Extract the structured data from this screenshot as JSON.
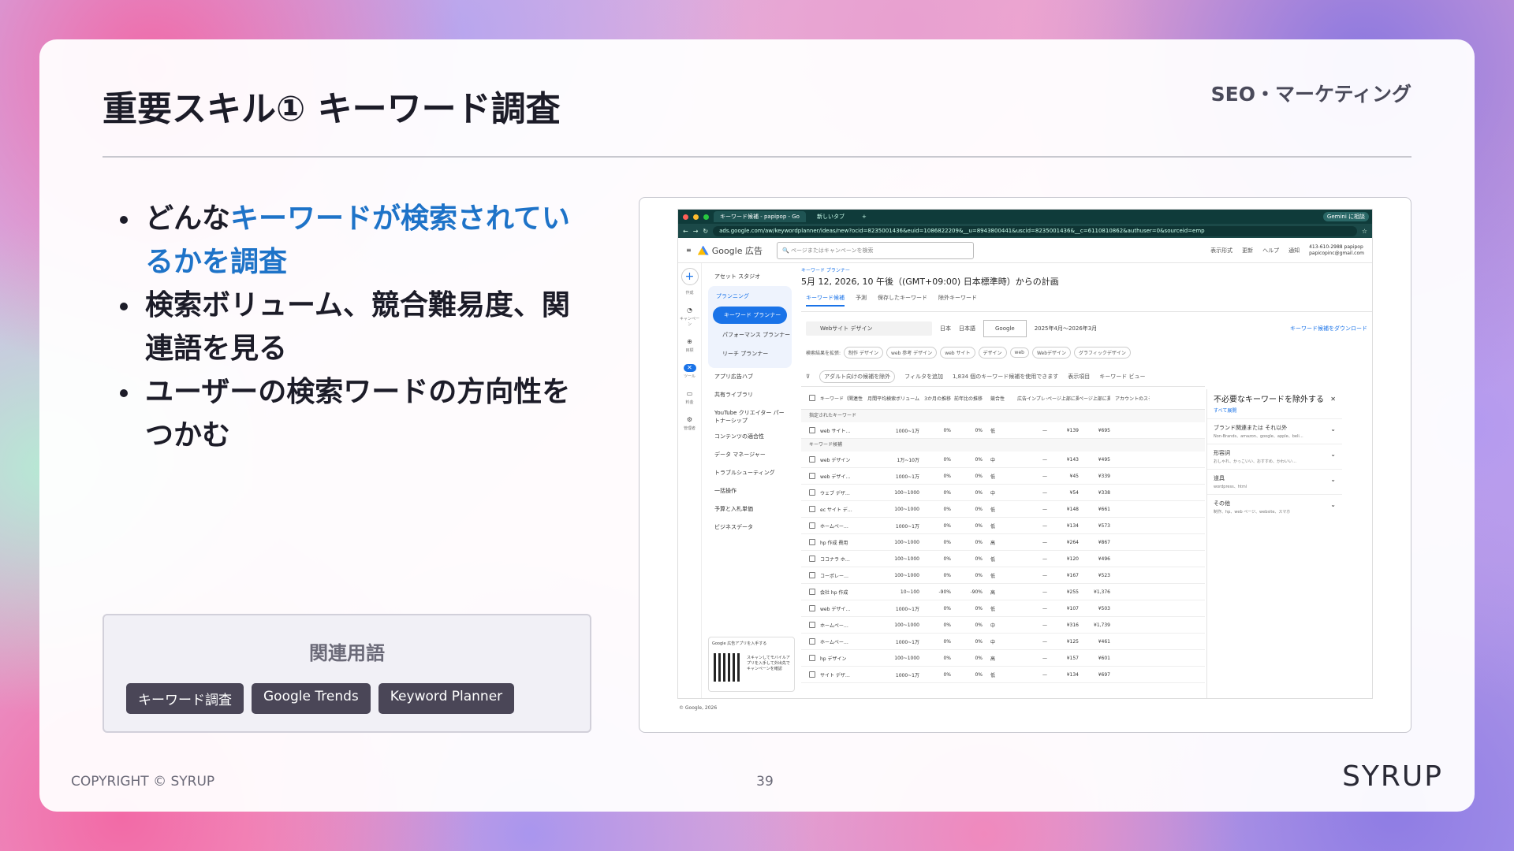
{
  "slide": {
    "title": "重要スキル① キーワード調査",
    "category": "SEO・マーケティング",
    "page": "39",
    "copyright": "COPYRIGHT © SYRUP",
    "logo": "SYRUP"
  },
  "bullets": [
    {
      "pre": "どんな",
      "hl": "キーワードが検索されているかを調査",
      "post": ""
    },
    {
      "pre": "検索ボリューム、競合難易度、関連語を見る",
      "hl": "",
      "post": ""
    },
    {
      "pre": "ユーザーの検索ワードの方向性をつかむ",
      "hl": "",
      "post": ""
    }
  ],
  "terms": {
    "heading": "関連用語",
    "tags": [
      "キーワード調査",
      "Google Trends",
      "Keyword Planner"
    ]
  },
  "browser": {
    "tab1": "キーワード候補 - papipop - Go",
    "tab2": "新しいタブ",
    "gemini": "Gemini に相談",
    "url": "ads.google.com/aw/keywordplanner/ideas/new?ocid=8235001436&euid=1086822209&__u=8943800441&uscid=8235001436&__c=6110810862&authuser=0&sourceid=emp",
    "brand": "Google 広告",
    "search_placeholder": "ページまたはキャンペーンを検索",
    "header_icons": [
      "表示形式",
      "更新",
      "ヘルプ",
      "通知"
    ],
    "account_line1": "413-610-2988 papipop",
    "account_line2": "papicopinc@gmail.com",
    "rail": [
      "作成",
      "キャンペーン",
      "目標",
      "ツール",
      "料金",
      "管理者"
    ],
    "nav": {
      "assets": "アセット スタジオ",
      "planning": "プランニング",
      "kp": "キーワード プランナー",
      "perf": "パフォーマンス プランナー",
      "reach": "リーチ プランナー",
      "others": [
        "アプリ広告ハブ",
        "共有ライブラリ",
        "YouTube クリエイター パートナーシップ",
        "コンテンツの適合性",
        "データ マネージャー",
        "トラブルシューティング",
        "一括操作",
        "予算と入札単価",
        "ビジネスデータ"
      ],
      "qr_title": "Google 広告アプリを入手する",
      "qr_text": "スキャンしてモバイルアプリを入手して外出先でキャンペーンを確認"
    },
    "breadcrumb": "キーワード プランナー",
    "plan_title": "5月 12, 2026, 10 午後（(GMT+09:00) 日本標準時）からの計画",
    "tabs": [
      "キーワード候補",
      "予測",
      "保存したキーワード",
      "除外キーワード"
    ],
    "filter": {
      "query": "Webサイト デザイン",
      "loc": "日本",
      "lang": "日本語",
      "network": "Google",
      "range": "2025年4月～2026年3月",
      "download": "キーワード候補をダウンロード"
    },
    "chips_label": "検索結果を拡張:",
    "chips": [
      "制作 デザイン",
      "web 参考 デザイン",
      "web サイト",
      "デザイン",
      "web",
      "Webデザイン",
      "グラフィックデザイン"
    ],
    "toolbar": {
      "adult": "アダルト向けの候補を除外",
      "addfilter": "フィルタを追加",
      "count": "1,834 個のキーワード候補を使用できます",
      "cols": "表示項目",
      "view": "キーワード ビュー"
    },
    "columns": [
      "キーワード（関連性の高い順）",
      "月間平均検索ボリューム",
      "3か月の推移",
      "前年比の推移",
      "競合性",
      "広告インプレッション",
      "ページ上部に掲載された入札単価（低額帯）",
      "ページ上部に掲載された入札単価（高額帯）",
      "アカウントのステータス"
    ],
    "group1": "指定されたキーワード",
    "group2": "キーワード候補",
    "provided": [
      [
        "web サイト…",
        "1000~1万",
        "0%",
        "0%",
        "低",
        "—",
        "¥139",
        "¥695"
      ]
    ],
    "rows": [
      [
        "web デザイン",
        "1万~10万",
        "0%",
        "0%",
        "中",
        "—",
        "¥143",
        "¥495"
      ],
      [
        "web デザイ…",
        "1000~1万",
        "0%",
        "0%",
        "低",
        "—",
        "¥45",
        "¥339"
      ],
      [
        "ウェブ デザ…",
        "100~1000",
        "0%",
        "0%",
        "中",
        "—",
        "¥54",
        "¥338"
      ],
      [
        "ec サイト デ…",
        "100~1000",
        "0%",
        "0%",
        "低",
        "—",
        "¥148",
        "¥661"
      ],
      [
        "ホームペー…",
        "1000~1万",
        "0%",
        "0%",
        "低",
        "—",
        "¥134",
        "¥573"
      ],
      [
        "hp 作成 費用",
        "100~1000",
        "0%",
        "0%",
        "高",
        "—",
        "¥264",
        "¥867"
      ],
      [
        "ココナラ ホ…",
        "100~1000",
        "0%",
        "0%",
        "低",
        "—",
        "¥120",
        "¥496"
      ],
      [
        "コーポレー…",
        "100~1000",
        "0%",
        "0%",
        "低",
        "—",
        "¥167",
        "¥523"
      ],
      [
        "会社 hp 作成",
        "10~100",
        "-90%",
        "-90%",
        "高",
        "—",
        "¥255",
        "¥1,376"
      ],
      [
        "web デザイ…",
        "1000~1万",
        "0%",
        "0%",
        "低",
        "—",
        "¥107",
        "¥503"
      ],
      [
        "ホームペー…",
        "100~1000",
        "0%",
        "0%",
        "中",
        "—",
        "¥316",
        "¥1,739"
      ],
      [
        "ホームペー…",
        "1000~1万",
        "0%",
        "0%",
        "中",
        "—",
        "¥125",
        "¥461"
      ],
      [
        "hp デザイン",
        "100~1000",
        "0%",
        "0%",
        "高",
        "—",
        "¥157",
        "¥601"
      ],
      [
        "サイト デザ…",
        "1000~1万",
        "0%",
        "0%",
        "低",
        "—",
        "¥134",
        "¥697"
      ]
    ],
    "side": {
      "title": "不必要なキーワードを除外する",
      "all": "すべて展開",
      "groups": [
        {
          "t": "ブランド関連または それ以外",
          "s": "Non-Brands、amazon、google、apple、beli…"
        },
        {
          "t": "形容詞",
          "s": "おしゃれ、かっこいい、おすすめ、かわいい…"
        },
        {
          "t": "道具",
          "s": "wordpress、html"
        },
        {
          "t": "その他",
          "s": "制作、hp、web ページ、website、スマホ"
        }
      ]
    },
    "footer": "© Google, 2026"
  }
}
